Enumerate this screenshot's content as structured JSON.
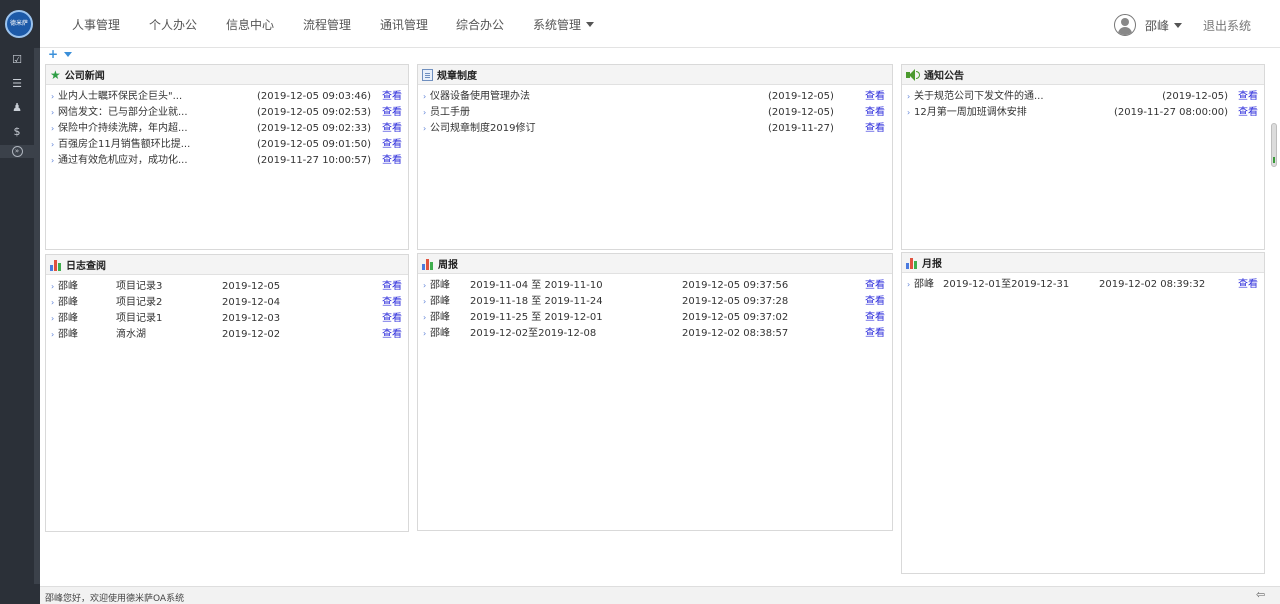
{
  "app": {
    "logo_text": "德米萨"
  },
  "nav": {
    "items": [
      "人事管理",
      "个人办公",
      "信息中心",
      "流程管理",
      "通讯管理",
      "综合办公",
      "系统管理"
    ],
    "user": "邵峰",
    "logout": "退出系统"
  },
  "rail": {
    "icons": [
      "checkbox-icon",
      "list-icon",
      "user-group-icon",
      "currency-icon",
      "collapse-icon"
    ]
  },
  "panels": {
    "news": {
      "title": "公司新闻",
      "items": [
        {
          "title": "业内人士瞩环保民企巨头\"...",
          "time": "(2019-12-05 09:03:46)",
          "action": "查看"
        },
        {
          "title": "网信发文：已与部分企业就...",
          "time": "(2019-12-05 09:02:53)",
          "action": "查看"
        },
        {
          "title": "保险中介持续洗牌，年内超...",
          "time": "(2019-12-05 09:02:33)",
          "action": "查看"
        },
        {
          "title": "百强房企11月销售额环比提...",
          "time": "(2019-12-05 09:01:50)",
          "action": "查看"
        },
        {
          "title": "通过有效危机应对，成功化...",
          "time": "(2019-11-27 10:00:57)",
          "action": "查看"
        }
      ]
    },
    "rules": {
      "title": "规章制度",
      "items": [
        {
          "title": "仪器设备使用管理办法",
          "time": "(2019-12-05)",
          "action": "查看"
        },
        {
          "title": "员工手册",
          "time": "(2019-12-05)",
          "action": "查看"
        },
        {
          "title": "公司规章制度2019修订",
          "time": "(2019-11-27)",
          "action": "查看"
        }
      ]
    },
    "notices": {
      "title": "通知公告",
      "items": [
        {
          "title": "关于规范公司下发文件的通...",
          "time": "(2019-12-05)",
          "action": "查看"
        },
        {
          "title": "12月第一周加班调休安排",
          "time": "(2019-11-27 08:00:00)",
          "action": "查看"
        }
      ]
    },
    "logs": {
      "title": "日志查阅",
      "items": [
        {
          "person": "邵峰",
          "title": "项目记录3",
          "date": "2019-12-05",
          "action": "查看"
        },
        {
          "person": "邵峰",
          "title": "项目记录2",
          "date": "2019-12-04",
          "action": "查看"
        },
        {
          "person": "邵峰",
          "title": "项目记录1",
          "date": "2019-12-03",
          "action": "查看"
        },
        {
          "person": "邵峰",
          "title": "滴水湖",
          "date": "2019-12-02",
          "action": "查看"
        }
      ]
    },
    "weekly": {
      "title": "周报",
      "items": [
        {
          "person": "邵峰",
          "range": "2019-11-04 至 2019-11-10",
          "time": "2019-12-05 09:37:56",
          "action": "查看"
        },
        {
          "person": "邵峰",
          "range": "2019-11-18 至 2019-11-24",
          "time": "2019-12-05 09:37:28",
          "action": "查看"
        },
        {
          "person": "邵峰",
          "range": "2019-11-25 至 2019-12-01",
          "time": "2019-12-05 09:37:02",
          "action": "查看"
        },
        {
          "person": "邵峰",
          "range": "2019-12-02至2019-12-08",
          "time": "2019-12-02 08:38:57",
          "action": "查看"
        }
      ]
    },
    "monthly": {
      "title": "月报",
      "items": [
        {
          "person": "邵峰",
          "range": "2019-12-01至2019-12-31",
          "time": "2019-12-02 08:39:32",
          "action": "查看"
        }
      ]
    }
  },
  "footer": {
    "text": "邵峰您好，欢迎使用德米萨OA系统"
  },
  "colors": {
    "rail": "#2b3038",
    "link": "#2a2adb",
    "bullet": "#5b7fd6"
  }
}
